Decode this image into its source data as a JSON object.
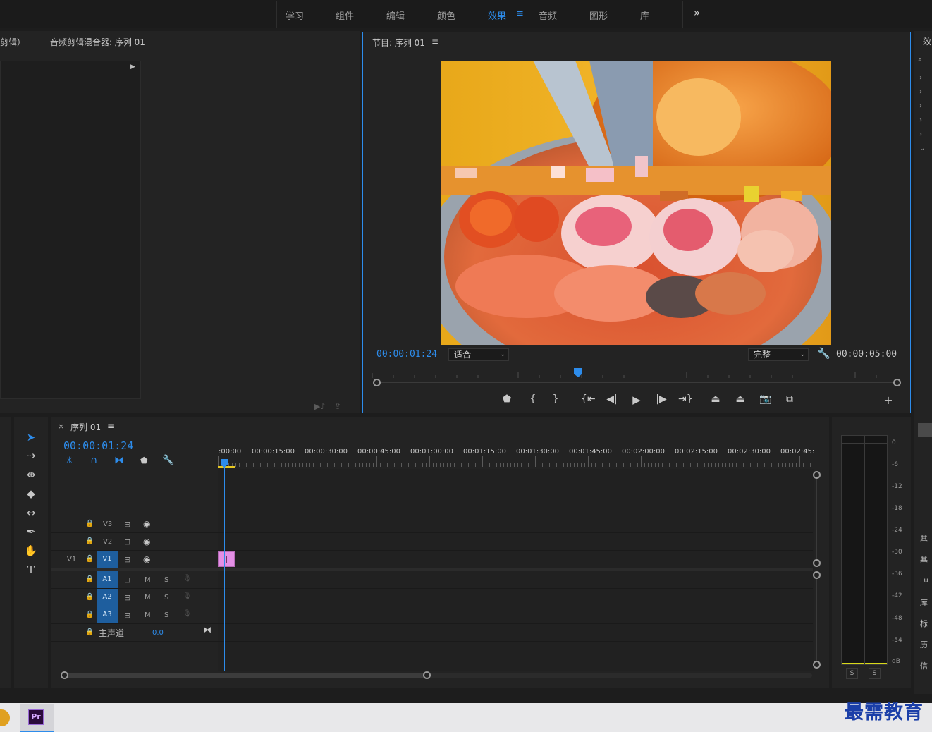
{
  "workspace_tabs": [
    {
      "label": "学习",
      "active": false
    },
    {
      "label": "组件",
      "active": false
    },
    {
      "label": "编辑",
      "active": false
    },
    {
      "label": "颜色",
      "active": false
    },
    {
      "label": "效果",
      "active": true
    },
    {
      "label": "音频",
      "active": false
    },
    {
      "label": "图形",
      "active": false
    },
    {
      "label": "库",
      "active": false
    }
  ],
  "workspace_menu_icon": "≡",
  "workspace_overflow_icon": "»",
  "source_panel": {
    "tab_partial": "剪辑）",
    "audio_mixer_tab": "音频剪辑混合器: 序列 01"
  },
  "program_monitor": {
    "title": "节目: 序列 01",
    "menu_icon": "≡",
    "current_timecode": "00:00:01:24",
    "zoom_value": "适合",
    "quality_value": "完整",
    "duration_timecode": "00:00:05:00"
  },
  "timeline": {
    "close_icon": "×",
    "title": "序列 01",
    "menu_icon": "≡",
    "current_timecode": "00:00:01:24",
    "ruler_labels": [
      ":00:00",
      "00:00:15:00",
      "00:00:30:00",
      "00:00:45:00",
      "00:01:00:00",
      "00:01:15:00",
      "00:01:30:00",
      "00:01:45:00",
      "00:02:00:00",
      "00:02:15:00",
      "00:02:30:00",
      "00:02:45:"
    ],
    "video_tracks": [
      {
        "name": "V3",
        "source": ""
      },
      {
        "name": "V2",
        "source": ""
      },
      {
        "name": "V1",
        "source": "V1"
      }
    ],
    "audio_tracks": [
      {
        "name": "A1",
        "m": "M",
        "s": "S"
      },
      {
        "name": "A2",
        "m": "M",
        "s": "S"
      },
      {
        "name": "A3",
        "m": "M",
        "s": "S"
      }
    ],
    "master": {
      "label": "主声道",
      "value": "0.0"
    }
  },
  "audio_meter": {
    "scale": [
      "0",
      "-6",
      "-12",
      "-18",
      "-24",
      "-30",
      "-36",
      "-42",
      "-48",
      "-54",
      "dB"
    ],
    "solo_labels": [
      "S",
      "S"
    ]
  },
  "right_panel": {
    "tab_partial": "效",
    "items": [
      "基",
      "基",
      "Lu",
      "库",
      "标",
      "历",
      "信"
    ]
  },
  "taskbar": {
    "app_label": "Pr",
    "watermark": "最需教育"
  },
  "colors": {
    "accent": "#2d8ceb",
    "panel": "#232323",
    "background": "#1d1d1d",
    "clip": "#e48fe5"
  }
}
